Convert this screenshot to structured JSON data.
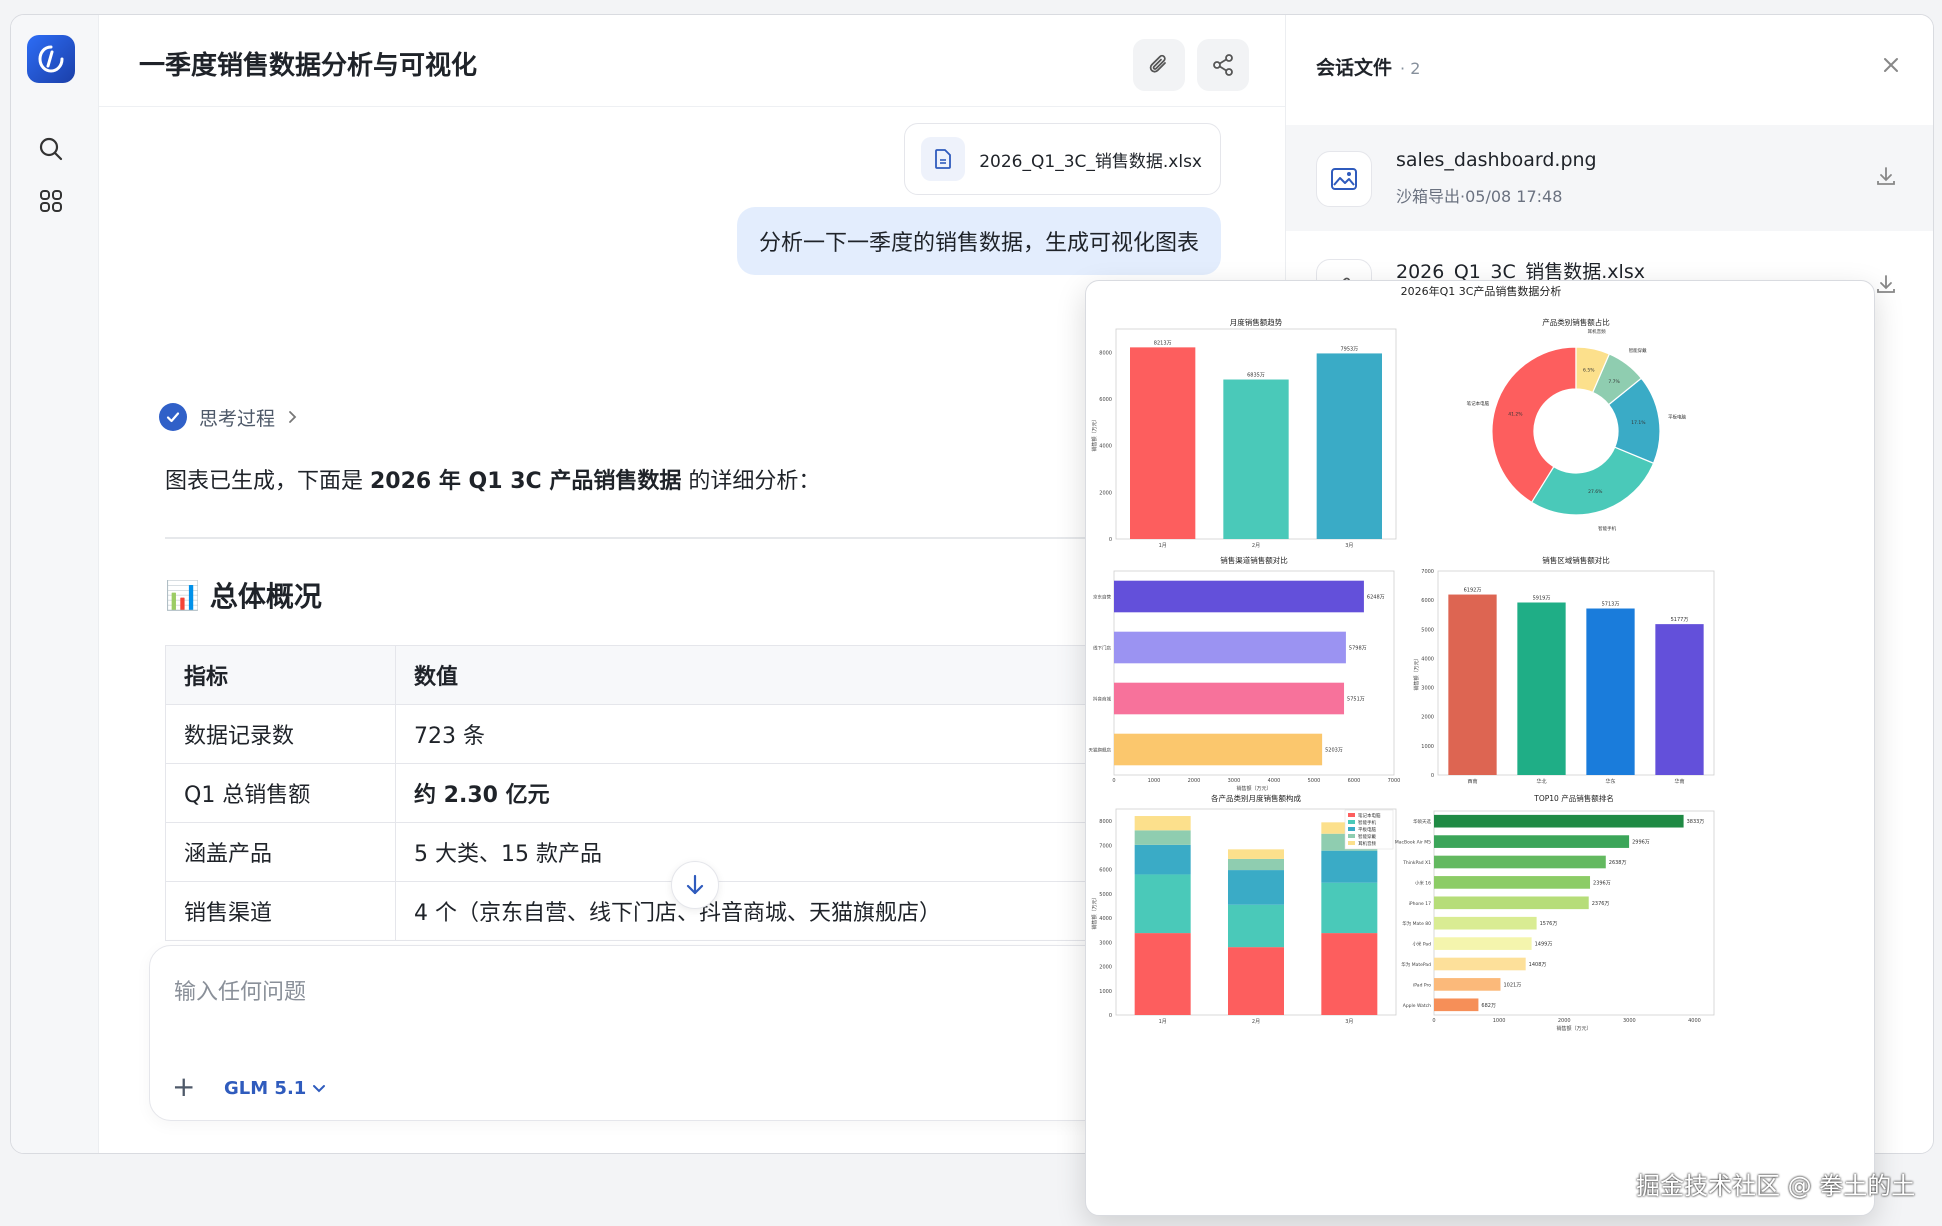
{
  "app": {
    "title": "一季度销售数据分析与可视化"
  },
  "chat": {
    "attachment_name": "2026_Q1_3C_销售数据.xlsx",
    "user_message": "分析一下一季度的销售数据，生成可视化图表",
    "thinking_label": "思考过程",
    "intro_prefix": "图表已生成，下面是 ",
    "intro_bold": "2026 年 Q1 3C 产品销售数据",
    "intro_suffix": " 的详细分析：",
    "section_emoji": "📊",
    "section_title": "总体概况",
    "table": {
      "headers": [
        "指标",
        "数值"
      ],
      "rows": [
        [
          "数据记录数",
          "723 条"
        ],
        [
          "Q1 总销售额",
          "约 2.30 亿元"
        ],
        [
          "涵盖产品",
          "5 大类、15 款产品"
        ],
        [
          "销售渠道",
          "4 个（京东自营、线下门店、抖音商城、天猫旗舰店）"
        ]
      ]
    }
  },
  "composer": {
    "placeholder": "输入任何问题",
    "model_label": "GLM 5.1"
  },
  "side_panel": {
    "title": "会话文件",
    "count": "· 2",
    "files": [
      {
        "name": "sales_dashboard.png",
        "meta": "沙箱导出·05/08 17:48"
      },
      {
        "name": "2026_Q1_3C_销售数据.xlsx",
        "meta": ""
      }
    ]
  },
  "colors": {
    "accent": "#2f5bbd",
    "user_bubble": "#e3edfd"
  },
  "chart_data": [
    {
      "type": "bar",
      "title": "月度销售额趋势",
      "suptitle": "2026年Q1 3C产品销售数据分析",
      "categories": [
        "1月",
        "2月",
        "3月"
      ],
      "values": [
        8213,
        6835,
        7953
      ],
      "data_labels": [
        "8213万",
        "6835万",
        "7953万"
      ],
      "ylabel": "销售额（万元）",
      "yticks": [
        "0",
        "2000",
        "4000",
        "6000",
        "8000"
      ],
      "ylim": [
        0,
        9000
      ],
      "colors": [
        "#fd5e5e",
        "#4ac9b9",
        "#3aabc6"
      ]
    },
    {
      "type": "pie",
      "title": "产品类别销售额占比",
      "categories": [
        "笔记本电脑",
        "智能手机",
        "平板电脑",
        "智能穿戴",
        "耳机音频"
      ],
      "values": [
        41.2,
        27.6,
        17.1,
        7.7,
        6.5
      ],
      "data_labels": [
        "41.2%",
        "27.6%",
        "17.1%",
        "7.7%",
        "6.5%"
      ],
      "colors": [
        "#fd5e5e",
        "#4ac9b9",
        "#3aabc6",
        "#8fcdb0",
        "#fce08c"
      ]
    },
    {
      "type": "bar",
      "orientation": "horizontal",
      "title": "销售渠道销售额对比",
      "categories": [
        "京东自营",
        "线下门店",
        "抖音商城",
        "天猫旗舰店"
      ],
      "values": [
        6248,
        5798,
        5751,
        5203
      ],
      "data_labels": [
        "6248万",
        "5798万",
        "5751万",
        "5203万"
      ],
      "xlabel": "销售额（万元）",
      "xticks": [
        "0",
        "1000",
        "2000",
        "3000",
        "4000",
        "5000",
        "6000",
        "7000"
      ],
      "xlim": [
        0,
        7000
      ],
      "colors": [
        "#6350da",
        "#9b93f2",
        "#f7729b",
        "#fbc76d"
      ]
    },
    {
      "type": "bar",
      "title": "销售区域销售额对比",
      "categories": [
        "西南",
        "华北",
        "华东",
        "华南"
      ],
      "values": [
        6192,
        5919,
        5713,
        5177
      ],
      "data_labels": [
        "6192万",
        "5919万",
        "5713万",
        "5177万"
      ],
      "ylabel": "销售额（万元）",
      "yticks": [
        "0",
        "1000",
        "2000",
        "3000",
        "4000",
        "5000",
        "6000",
        "7000"
      ],
      "ylim": [
        0,
        7000
      ],
      "colors": [
        "#dd6552",
        "#1fae86",
        "#1a7cdb",
        "#6350da"
      ]
    },
    {
      "type": "bar",
      "stacked": true,
      "title": "各产品类别月度销售额构成",
      "categories": [
        "1月",
        "2月",
        "3月"
      ],
      "ylabel": "销售额（万元）",
      "yticks": [
        "0",
        "1000",
        "2000",
        "3000",
        "4000",
        "5000",
        "6000",
        "7000",
        "8000"
      ],
      "ylim": [
        0,
        8500
      ],
      "series": [
        {
          "name": "笔记本电脑",
          "values": [
            3380,
            2800,
            3380
          ],
          "color": "#fd5e5e"
        },
        {
          "name": "智能手机",
          "values": [
            2420,
            1750,
            2080
          ],
          "color": "#4ac9b9"
        },
        {
          "name": "平板电脑",
          "values": [
            1220,
            1430,
            1320
          ],
          "color": "#3aabc6"
        },
        {
          "name": "智能穿戴",
          "values": [
            600,
            460,
            700
          ],
          "color": "#8fcdb0"
        },
        {
          "name": "耳机音频",
          "values": [
            590,
            395,
            470
          ],
          "color": "#fce08c"
        }
      ]
    },
    {
      "type": "bar",
      "orientation": "horizontal",
      "title": "TOP10 产品销售额排名",
      "categories": [
        "华硕天选",
        "MacBook Air M5",
        "ThinkPad X1",
        "小米 16",
        "iPhone 17",
        "华为 Mate 80",
        "小米 Pad",
        "华为 MatePad",
        "iPad Pro",
        "Apple Watch"
      ],
      "values": [
        3833,
        2996,
        2638,
        2396,
        2376,
        1576,
        1499,
        1408,
        1021,
        682
      ],
      "data_labels": [
        "3833万",
        "2996万",
        "2638万",
        "2396万",
        "2376万",
        "1576万",
        "1499万",
        "1408万",
        "1021万",
        "682万"
      ],
      "xlabel": "销售额（万元）",
      "xticks": [
        "0",
        "1000",
        "2000",
        "3000",
        "4000"
      ],
      "xlim": [
        0,
        4300
      ],
      "colors": [
        "#1f8a44",
        "#3ba559",
        "#63b960",
        "#8ccc66",
        "#b6dd79",
        "#d9ec93",
        "#f4f5ad",
        "#fde09a",
        "#fbb97a",
        "#f68f58"
      ]
    }
  ],
  "watermark": "掘金技术社区 @ 拳土的土"
}
